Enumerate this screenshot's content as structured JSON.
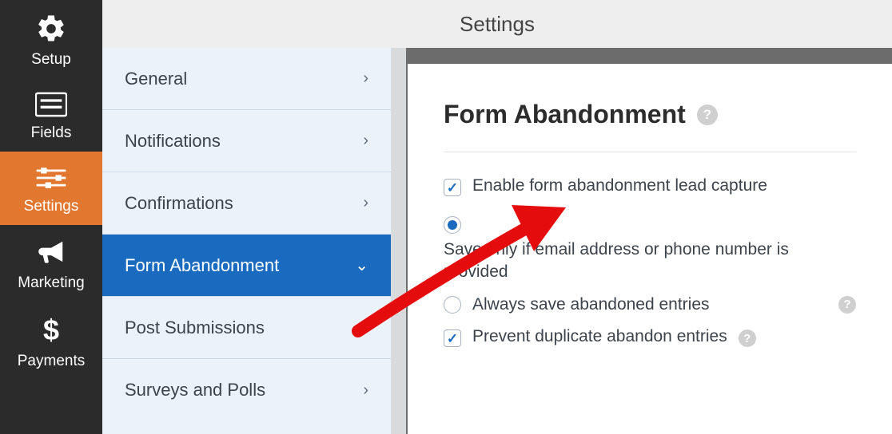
{
  "rail": {
    "items": [
      {
        "label": "Setup"
      },
      {
        "label": "Fields"
      },
      {
        "label": "Settings"
      },
      {
        "label": "Marketing"
      },
      {
        "label": "Payments"
      }
    ],
    "active_index": 2
  },
  "header": {
    "title": "Settings"
  },
  "settings_menu": {
    "items": [
      {
        "label": "General"
      },
      {
        "label": "Notifications"
      },
      {
        "label": "Confirmations"
      },
      {
        "label": "Form Abandonment"
      },
      {
        "label": "Post Submissions"
      },
      {
        "label": "Surveys and Polls"
      }
    ],
    "selected_index": 3
  },
  "panel": {
    "title": "Form Abandonment",
    "enable_label": "Enable form abandonment lead capture",
    "enable_checked": true,
    "save_mode": {
      "options": [
        {
          "label": "Save only if email address or phone number is provided",
          "selected": true,
          "help": false
        },
        {
          "label": "Always save abandoned entries",
          "selected": false,
          "help": true
        }
      ]
    },
    "prevent_dup_label": "Prevent duplicate abandon entries",
    "prevent_dup_checked": true
  },
  "colors": {
    "accent": "#e27730",
    "primary": "#1a6bbf"
  }
}
